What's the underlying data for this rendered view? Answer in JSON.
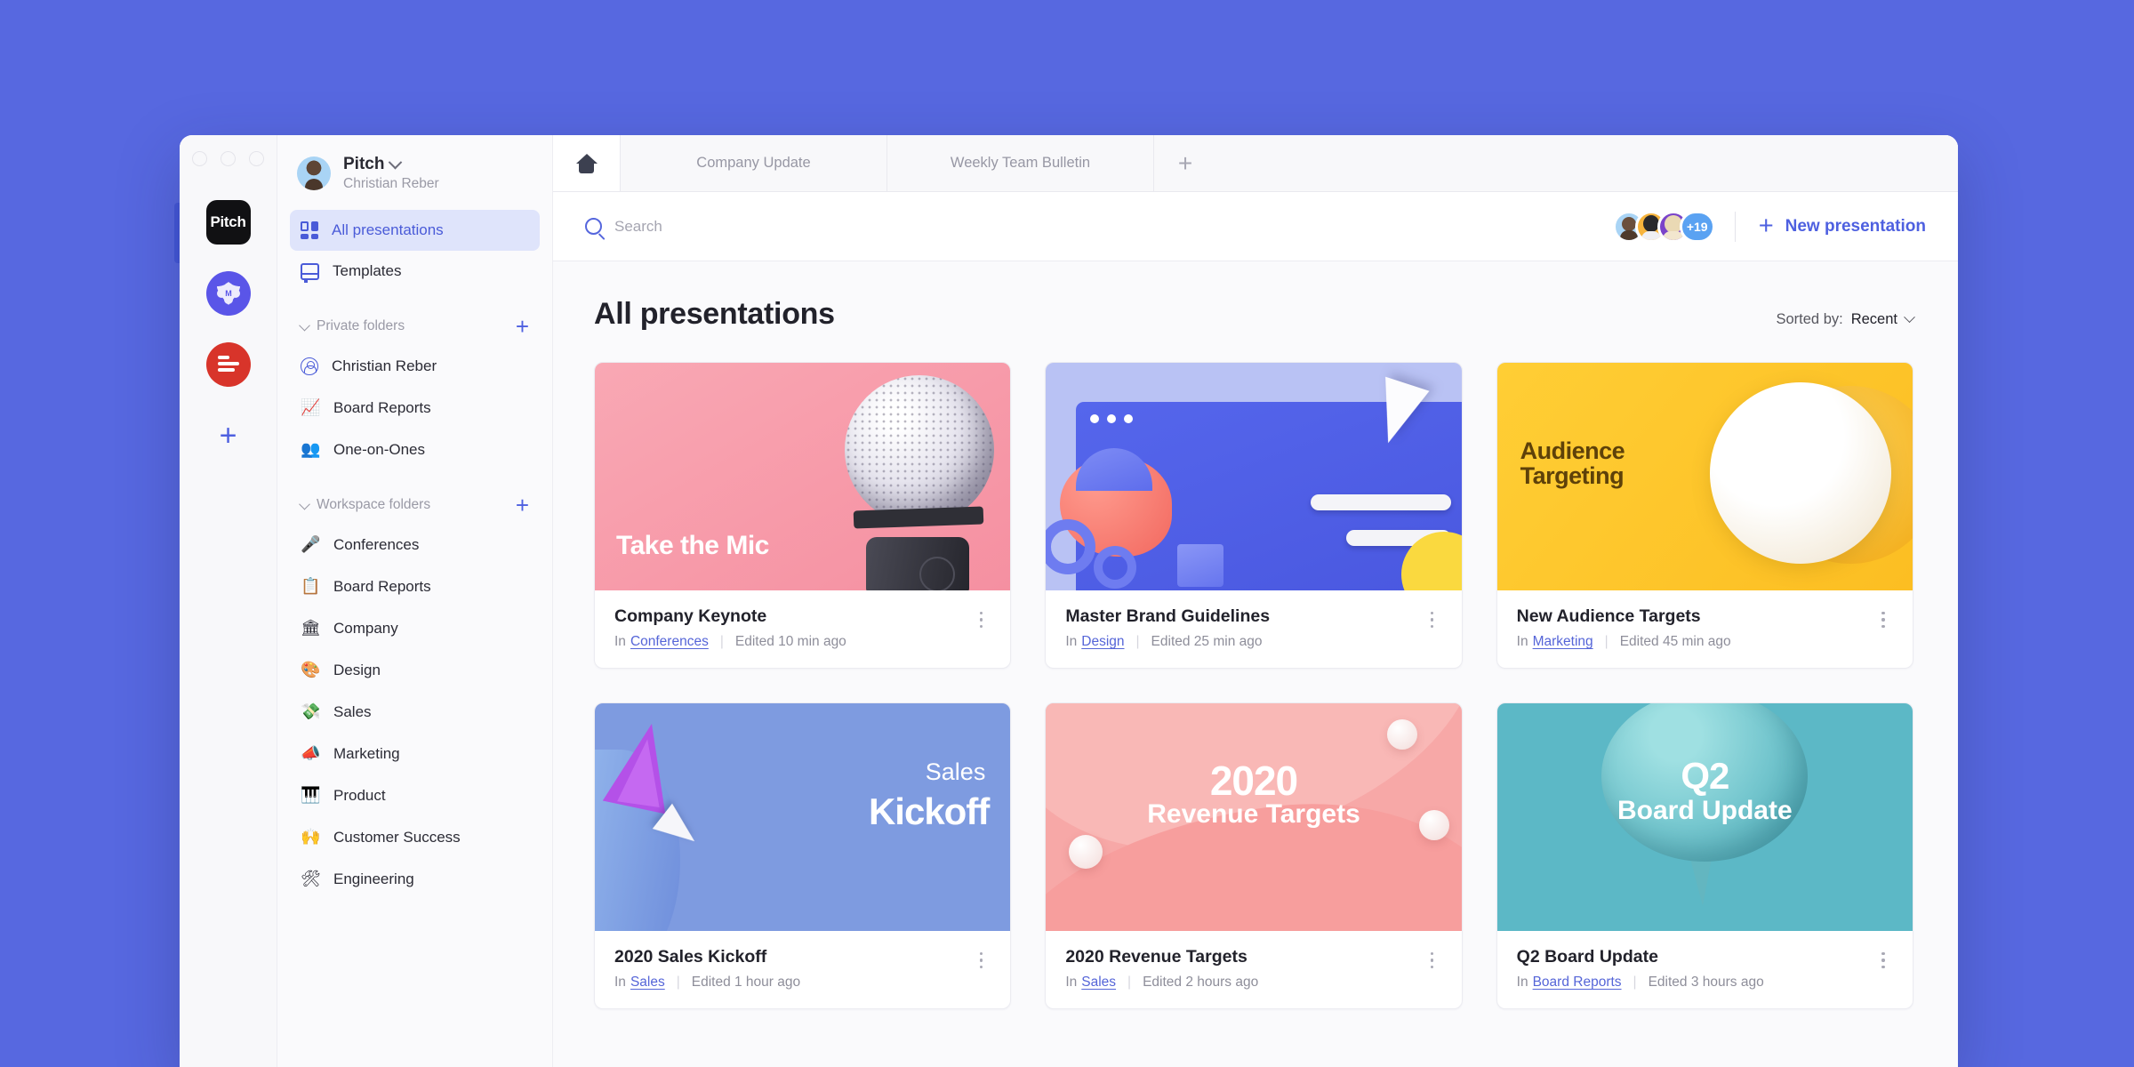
{
  "window": {
    "traffic_lights": [
      "close",
      "minimize",
      "maximize"
    ]
  },
  "rail": {
    "workspaces": [
      {
        "name": "Pitch",
        "label": "Pitch",
        "type": "text",
        "color": "#111113"
      },
      {
        "name": "M workspace",
        "label": "M",
        "type": "badge",
        "color": "#5A55E8"
      },
      {
        "name": "Red workspace",
        "label": "",
        "type": "lines",
        "color": "#D8342A"
      }
    ],
    "add_label": "+"
  },
  "sidebar": {
    "account": {
      "workspace": "Pitch",
      "user": "Christian Reber"
    },
    "nav": [
      {
        "label": "All presentations",
        "icon": "grid-icon",
        "active": true
      },
      {
        "label": "Templates",
        "icon": "templates-icon",
        "active": false
      }
    ],
    "private_section": {
      "title": "Private folders",
      "add_label": "+",
      "folders": [
        {
          "label": "Christian Reber",
          "icon": "person-circle-icon",
          "emoji": ""
        },
        {
          "label": "Board Reports",
          "icon": "chart-emoji",
          "emoji": "📈"
        },
        {
          "label": "One-on-Ones",
          "icon": "busts-emoji",
          "emoji": "👥"
        }
      ]
    },
    "workspace_section": {
      "title": "Workspace folders",
      "add_label": "+",
      "folders": [
        {
          "label": "Conferences",
          "emoji": "🎤"
        },
        {
          "label": "Board Reports",
          "emoji": "📋"
        },
        {
          "label": "Company",
          "emoji": "🏛"
        },
        {
          "label": "Design",
          "emoji": "🎨"
        },
        {
          "label": "Sales",
          "emoji": "💸"
        },
        {
          "label": "Marketing",
          "emoji": "📣"
        },
        {
          "label": "Product",
          "emoji": "🎹"
        },
        {
          "label": "Customer Success",
          "emoji": "🙌"
        },
        {
          "label": "Engineering",
          "emoji": "🛠"
        }
      ]
    }
  },
  "tabs": {
    "home_icon": "home-icon",
    "items": [
      {
        "label": "Company Update",
        "active": false
      },
      {
        "label": "Weekly Team Bulletin",
        "active": false
      }
    ],
    "add_label": "+"
  },
  "toolbar": {
    "search_placeholder": "Search",
    "search_value": "",
    "avatars_overflow": "+19",
    "new_presentation_label": "New presentation",
    "new_presentation_plus": "+"
  },
  "content": {
    "page_title": "All presentations",
    "sorted_by_label": "Sorted by:",
    "sorted_by_value": "Recent"
  },
  "cards": [
    {
      "thumb_title": "Take the Mic",
      "title": "Company Keynote",
      "in_label": "In",
      "folder": "Conferences",
      "edited": "Edited 10 min ago",
      "accent": "#F79AA9"
    },
    {
      "thumb_title": "",
      "title": "Master Brand Guidelines",
      "in_label": "In",
      "folder": "Design",
      "edited": "Edited 25 min ago",
      "accent": "#B9C2F4"
    },
    {
      "thumb_title_line1": "Audience",
      "thumb_title_line2": "Targeting",
      "title": "New Audience Targets",
      "in_label": "In",
      "folder": "Marketing",
      "edited": "Edited 45 min ago",
      "accent": "#FCBE22"
    },
    {
      "thumb_title_line1": "Sales",
      "thumb_title_line2": "Kickoff",
      "title": "2020 Sales Kickoff",
      "in_label": "In",
      "folder": "Sales",
      "edited": "Edited 1 hour ago",
      "accent": "#7E9BE0"
    },
    {
      "thumb_title_line1": "2020",
      "thumb_title_line2": "Revenue Targets",
      "title": "2020 Revenue Targets",
      "in_label": "In",
      "folder": "Sales",
      "edited": "Edited 2 hours ago",
      "accent": "#F7A8A7"
    },
    {
      "thumb_title_line1": "Q2",
      "thumb_title_line2": "Board Update",
      "title": "Q2 Board Update",
      "in_label": "In",
      "folder": "Board Reports",
      "edited": "Edited 3 hours ago",
      "accent": "#5CB8C6"
    }
  ],
  "colors": {
    "desktop_background": "#5768E0",
    "accent": "#4E60E0",
    "sidebar_active_bg": "#DFE4FB",
    "link": "#5565D8"
  }
}
